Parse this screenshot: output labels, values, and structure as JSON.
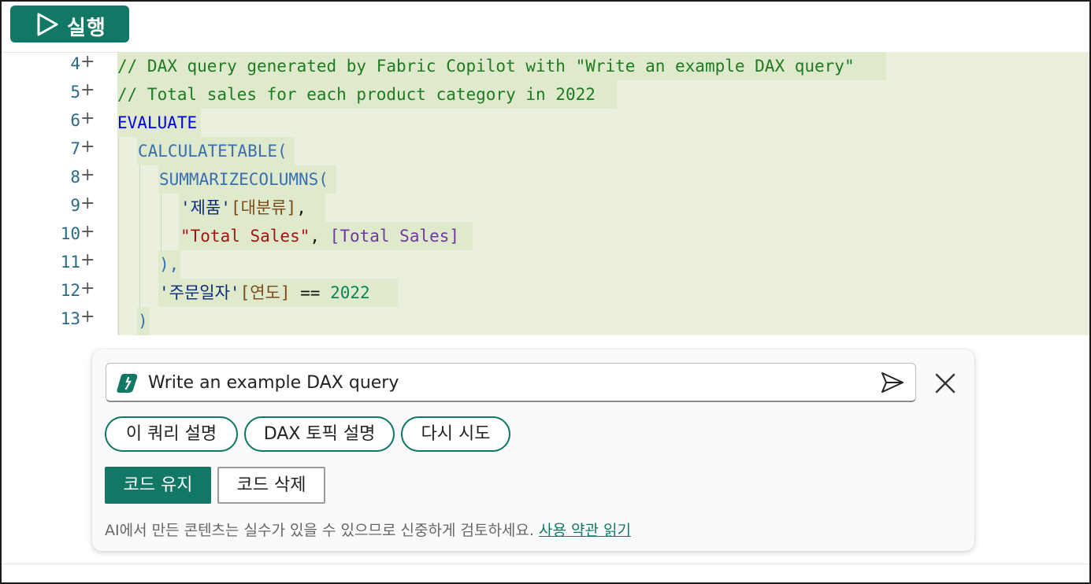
{
  "toolbar": {
    "run_label": "실행"
  },
  "editor": {
    "lines": [
      {
        "num": "4"
      },
      {
        "num": "5"
      },
      {
        "num": "6"
      },
      {
        "num": "7"
      },
      {
        "num": "8"
      },
      {
        "num": "9"
      },
      {
        "num": "10"
      },
      {
        "num": "11"
      },
      {
        "num": "12"
      },
      {
        "num": "13"
      }
    ],
    "code": {
      "l4": "// DAX query generated by Fabric Copilot with \"Write an example DAX query\"",
      "l5": "// Total sales for each product category in 2022",
      "l6": "EVALUATE",
      "l7": "CALCULATETABLE(",
      "l8": "SUMMARIZECOLUMNS(",
      "l9_table": "'제품'",
      "l9_col": "[대분류]",
      "l9_comma": ",",
      "l10_str": "\"Total Sales\"",
      "l10_comma": ", ",
      "l10_meas": "[Total Sales]",
      "l11": "),",
      "l12_table": "'주문일자'",
      "l12_col": "[연도]",
      "l12_op": " == ",
      "l12_num": "2022",
      "l13": ")"
    }
  },
  "copilot": {
    "prompt": "Write an example DAX query",
    "chips": [
      "이 쿼리 설명",
      "DAX 토픽 설명",
      "다시 시도"
    ],
    "keep_label": "코드 유지",
    "delete_label": "코드 삭제",
    "disclaimer": "AI에서 만든 콘텐츠는 실수가 있을 수 있으므로 신중하게 검토하세요.",
    "terms_link": "사용 약관 읽기"
  },
  "colors": {
    "accent": "#117865",
    "highlight": "#e8f0dc"
  }
}
